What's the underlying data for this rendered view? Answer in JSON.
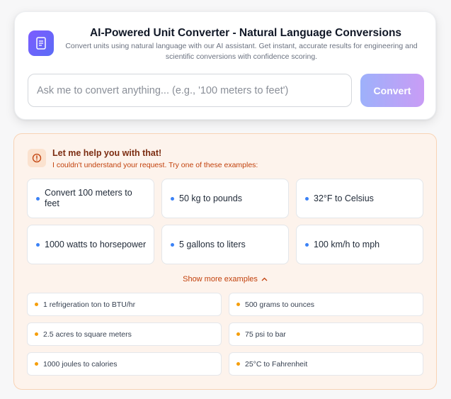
{
  "header": {
    "app_icon": "document-icon",
    "title": "AI-Powered Unit Converter - Natural Language Conversions",
    "subtitle": "Convert units using natural language with our AI assistant. Get instant, accurate results for engineering and scientific conversions with confidence scoring."
  },
  "input": {
    "value": "",
    "placeholder": "Ask me to convert anything... (e.g., '100 meters to feet')"
  },
  "convert_button": {
    "label": "Convert"
  },
  "help": {
    "icon": "alert-circle-icon",
    "title": "Let me help you with that!",
    "subtitle": "I couldn't understand your request. Try one of these examples:",
    "examples": [
      "Convert 100 meters to feet",
      "50 kg to pounds",
      "32°F to Celsius",
      "1000 watts to horsepower",
      "5 gallons to liters",
      "100 km/h to mph"
    ],
    "show_more_label": "Show more examples",
    "more_examples": [
      "1 refrigeration ton to BTU/hr",
      "500 grams to ounces",
      "2.5 acres to square meters",
      "75 psi to bar",
      "1000 joules to calories",
      "25°C to Fahrenheit"
    ]
  },
  "colors": {
    "accent_gradient_start": "#9db1fb",
    "accent_gradient_end": "#c99cf5",
    "help_background": "#fdf3ec",
    "help_text": "#c2410c",
    "example_dot": "#3b82f6",
    "more_example_dot": "#f59e0b"
  }
}
